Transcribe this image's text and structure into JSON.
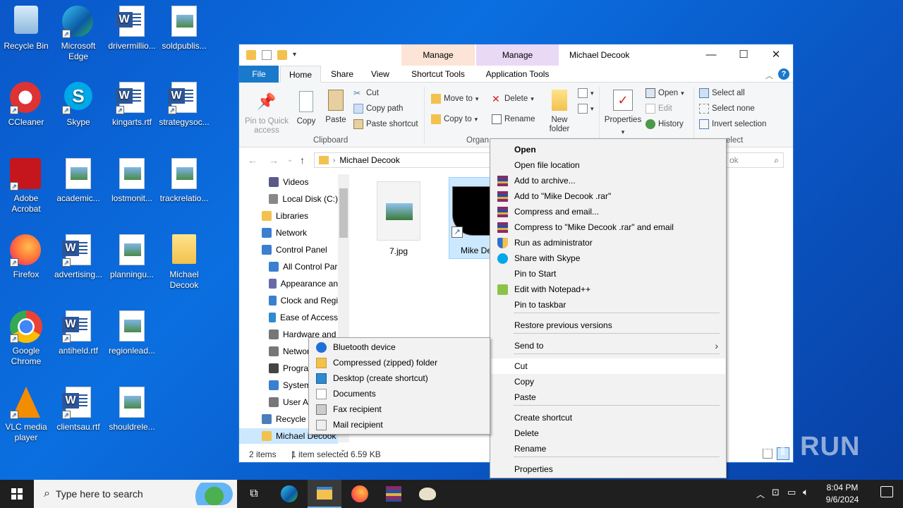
{
  "desktop": {
    "icons": [
      {
        "label": "Recycle Bin",
        "icon": "recycle-bin-icon"
      },
      {
        "label": "Microsoft Edge",
        "icon": "edge-icon"
      },
      {
        "label": "drivermillio...",
        "icon": "word-doc-icon"
      },
      {
        "label": "soldpublis...",
        "icon": "image-file-icon"
      },
      {
        "label": "CCleaner",
        "icon": "ccleaner-icon"
      },
      {
        "label": "Skype",
        "icon": "skype-icon"
      },
      {
        "label": "kingarts.rtf",
        "icon": "word-doc-icon"
      },
      {
        "label": "strategysoc...",
        "icon": "word-doc-icon"
      },
      {
        "label": "Adobe Acrobat",
        "icon": "acrobat-icon"
      },
      {
        "label": "academic...",
        "icon": "image-file-icon"
      },
      {
        "label": "lostmonit...",
        "icon": "image-file-icon"
      },
      {
        "label": "trackrelatio...",
        "icon": "image-file-icon"
      },
      {
        "label": "Firefox",
        "icon": "firefox-icon"
      },
      {
        "label": "advertising...",
        "icon": "word-doc-icon"
      },
      {
        "label": "planningu...",
        "icon": "image-file-icon"
      },
      {
        "label": "Michael Decook",
        "icon": "folder-icon"
      },
      {
        "label": "Google Chrome",
        "icon": "chrome-icon"
      },
      {
        "label": "antiheld.rtf",
        "icon": "word-doc-icon"
      },
      {
        "label": "regionlead...",
        "icon": "image-file-icon"
      },
      {
        "label": "VLC media player",
        "icon": "vlc-icon"
      },
      {
        "label": "clientsau.rtf",
        "icon": "word-doc-icon"
      },
      {
        "label": "shouldrele...",
        "icon": "image-file-icon"
      }
    ]
  },
  "explorer": {
    "title": "Michael Decook",
    "context_tabs": [
      {
        "group": "Manage",
        "tab": "Shortcut Tools",
        "color": "#fce4d6"
      },
      {
        "group": "Manage",
        "tab": "Application Tools",
        "color": "#ead9f5"
      }
    ],
    "tabs": [
      "File",
      "Home",
      "Share",
      "View"
    ],
    "ribbon": {
      "clipboard": {
        "pin": "Pin to Quick access",
        "copy": "Copy",
        "paste": "Paste",
        "cut": "Cut",
        "copy_path": "Copy path",
        "paste_shortcut": "Paste shortcut",
        "group": "Clipboard"
      },
      "organize": {
        "move_to": "Move to",
        "copy_to": "Copy to",
        "delete": "Delete",
        "rename": "Rename",
        "group": "Organ"
      },
      "new": {
        "new_folder": "New folder"
      },
      "open": {
        "properties": "Properties",
        "open": "Open",
        "edit": "Edit",
        "history": "History"
      },
      "select": {
        "select_all": "Select all",
        "select_none": "Select none",
        "invert": "Invert selection",
        "group": "elect"
      }
    },
    "address": {
      "path": "Michael Decook",
      "search_placeholder": "ok"
    },
    "nav": [
      {
        "label": "Videos",
        "indent": 1
      },
      {
        "label": "Local Disk (C:)",
        "indent": 1
      },
      {
        "label": "Libraries",
        "indent": 0
      },
      {
        "label": "Network",
        "indent": 0
      },
      {
        "label": "Control Panel",
        "indent": 0
      },
      {
        "label": "All Control Par",
        "indent": 1
      },
      {
        "label": "Appearance an",
        "indent": 1
      },
      {
        "label": "Clock and Regi",
        "indent": 1
      },
      {
        "label": "Ease of Access",
        "indent": 1
      },
      {
        "label": "Hardware and",
        "indent": 1
      },
      {
        "label": "Networ",
        "indent": 1
      },
      {
        "label": "Progra",
        "indent": 1
      },
      {
        "label": "System",
        "indent": 1
      },
      {
        "label": "User Ac",
        "indent": 1
      },
      {
        "label": "Recycle B",
        "indent": 0
      },
      {
        "label": "Michael Decook",
        "indent": 0
      }
    ],
    "files": [
      {
        "name": "7.jpg"
      },
      {
        "name": "Mike De"
      }
    ],
    "status": {
      "items": "2 items",
      "selected": "1 item selected",
      "size": "6.59 KB"
    }
  },
  "context_menu": {
    "items": [
      {
        "label": "Open",
        "bold": true,
        "icon": ""
      },
      {
        "label": "Open file location",
        "icon": ""
      },
      {
        "label": "Add to archive...",
        "icon": "winrar-icon"
      },
      {
        "label": "Add to \"Mike Decook .rar\"",
        "icon": "winrar-icon"
      },
      {
        "label": "Compress and email...",
        "icon": "winrar-icon"
      },
      {
        "label": "Compress to \"Mike Decook .rar\" and email",
        "icon": "winrar-icon"
      },
      {
        "label": "Run as administrator",
        "icon": "shield-icon"
      },
      {
        "label": "Share with Skype",
        "icon": "skype-icon"
      },
      {
        "label": "Pin to Start",
        "icon": ""
      },
      {
        "label": "Edit with Notepad++",
        "icon": "notepadpp-icon"
      },
      {
        "label": "Pin to taskbar",
        "icon": ""
      },
      {
        "label": "Restore previous versions",
        "icon": ""
      },
      {
        "label": "Send to",
        "icon": ""
      },
      {
        "label": "Cut",
        "icon": ""
      },
      {
        "label": "Copy",
        "icon": ""
      },
      {
        "label": "Paste",
        "icon": ""
      },
      {
        "label": "Create shortcut",
        "icon": ""
      },
      {
        "label": "Delete",
        "icon": ""
      },
      {
        "label": "Rename",
        "icon": ""
      },
      {
        "label": "Properties",
        "icon": ""
      }
    ],
    "send_to": [
      {
        "label": "Bluetooth device",
        "icon": "bluetooth-icon"
      },
      {
        "label": "Compressed (zipped) folder",
        "icon": "zip-folder-icon"
      },
      {
        "label": "Desktop (create shortcut)",
        "icon": "desktop-icon"
      },
      {
        "label": "Documents",
        "icon": "documents-icon"
      },
      {
        "label": "Fax recipient",
        "icon": "fax-icon"
      },
      {
        "label": "Mail recipient",
        "icon": "mail-icon"
      }
    ]
  },
  "taskbar": {
    "search_placeholder": "Type here to search",
    "time": "8:04 PM",
    "date": "9/6/2024"
  },
  "watermark": "ANY RUN"
}
